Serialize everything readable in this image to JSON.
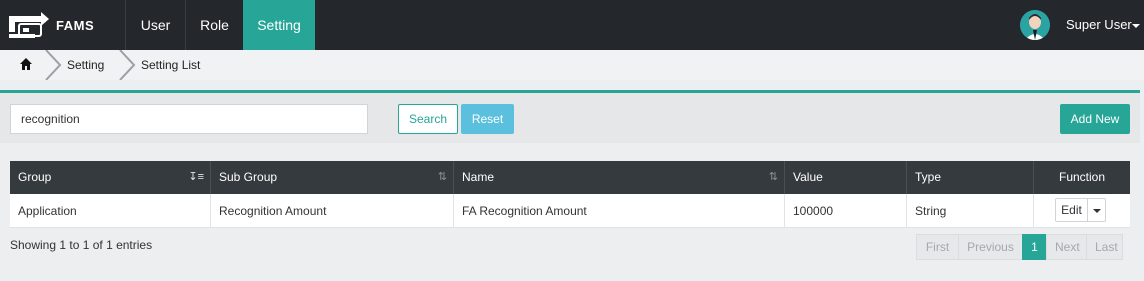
{
  "brand": {
    "name": "FAMS"
  },
  "nav": {
    "items": [
      {
        "label": "User"
      },
      {
        "label": "Role"
      },
      {
        "label": "Setting"
      }
    ],
    "user_name": "Super User"
  },
  "breadcrumb": {
    "items": [
      "Setting",
      "Setting List"
    ]
  },
  "toolbar": {
    "search_value": "recognition",
    "search_label": "Search",
    "reset_label": "Reset",
    "add_label": "Add New"
  },
  "table": {
    "columns": [
      "Group",
      "Sub Group",
      "Name",
      "Value",
      "Type",
      "Function"
    ],
    "rows": [
      {
        "group": "Application",
        "sub_group": "Recognition Amount",
        "name": "FA Recognition Amount",
        "value": "100000",
        "type": "String",
        "function": "Edit"
      }
    ]
  },
  "footer": {
    "info": "Showing 1 to 1 of 1 entries",
    "pager": {
      "first": "First",
      "previous": "Previous",
      "current": "1",
      "next": "Next",
      "last": "Last"
    }
  },
  "colors": {
    "accent": "#27a597",
    "nav_bg": "#24272b",
    "header_bg": "#353a3f",
    "info": "#5bc0de"
  }
}
